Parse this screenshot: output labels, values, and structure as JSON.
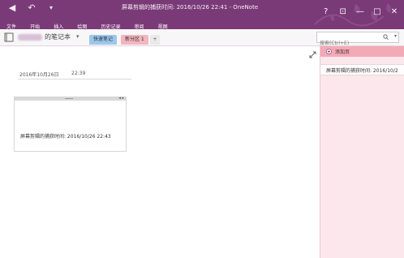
{
  "window": {
    "title": "屏幕剪辑的捕获时间: 2016/10/26 22:41 - OneNote",
    "help": "?",
    "minimize": "—",
    "maximize": "□",
    "close": "✕"
  },
  "quick_access": {
    "back": "◀",
    "undo": "↶",
    "customize": "▾"
  },
  "ribbon": {
    "tabs": [
      "文件",
      "开始",
      "插入",
      "绘图",
      "历史记录",
      "审阅",
      "视图"
    ]
  },
  "notebook": {
    "name": "的笔记本",
    "caret": "▾",
    "tabs": [
      {
        "label": "快速笔记"
      },
      {
        "label": "新分区 1"
      }
    ],
    "add_tab": "+"
  },
  "search": {
    "placeholder": "搜索(Ctrl+E)",
    "caret": "▾"
  },
  "note": {
    "date": "2016年10月26日",
    "time": "22:39",
    "clip_arrows": "◂ ▸",
    "clip_caption": "屏幕剪辑的捕获时间: 2016/10/26 22:43"
  },
  "pages_pane": {
    "add_page": "添加页",
    "items": [
      {
        "label": "屏幕剪辑的捕获时间: 2016/10/2"
      }
    ]
  },
  "colors": {
    "titlebar": "#7a3a77",
    "tab_quick": "#9dc7ea",
    "tab_new": "#f2b6c0",
    "pages_bg": "#fce8ec",
    "add_page_bg": "#f4a9b6"
  }
}
